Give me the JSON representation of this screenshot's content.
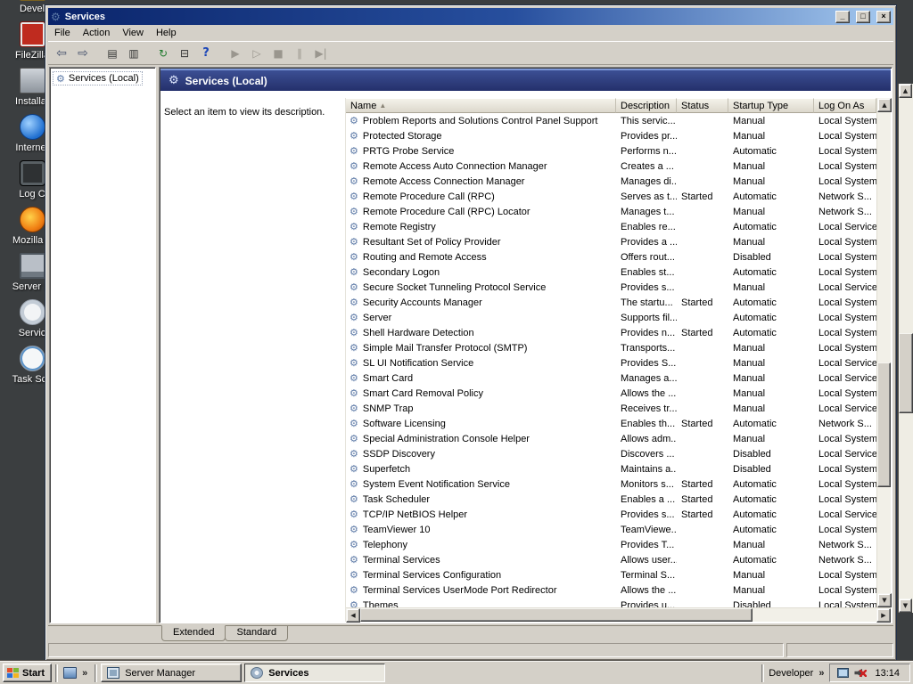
{
  "colors": {
    "desktop_background": "#3b3e40",
    "window_chrome": "#d4d0c8",
    "titlebar_gradient_left": "#0a246a",
    "titlebar_gradient_right": "#a6caf0",
    "pane_header_blue": "#24306b",
    "taskbar": "#d4d0c8"
  },
  "icons": {
    "gear_glyph": "⚙",
    "scroll_up": "▲",
    "scroll_down": "▼",
    "scroll_left": "◀",
    "scroll_right": "▶"
  },
  "desktop": {
    "icons": [
      {
        "label": "Devel",
        "icon": "developer-item-icon"
      },
      {
        "label": "FileZilla",
        "icon": "filezilla-icon"
      },
      {
        "label": "Installat",
        "icon": "installer-icon"
      },
      {
        "label": "Internet",
        "icon": "internet-icon"
      },
      {
        "label": "Log C",
        "icon": "log-icon"
      },
      {
        "label": "Mozilla F",
        "icon": "firefox-icon"
      },
      {
        "label": "Server M",
        "icon": "server-icon"
      },
      {
        "label": "Servic",
        "icon": "services-icon"
      },
      {
        "label": "Task Sch",
        "icon": "task-scheduler-icon"
      }
    ]
  },
  "window": {
    "title": "Services",
    "title_icon_glyph": "⚙",
    "controls": {
      "minimize": "_",
      "maximize": "□",
      "close": "×"
    },
    "menu_items": [
      {
        "label": "File"
      },
      {
        "label": "Action"
      },
      {
        "label": "View"
      },
      {
        "label": "Help"
      }
    ],
    "toolbar": [
      {
        "name": "back-button",
        "glyph": "⇦"
      },
      {
        "name": "forward-button",
        "glyph": "⇨"
      },
      {
        "name": "show-console-tree-button",
        "glyph": "▤"
      },
      {
        "name": "export-list-button",
        "glyph": "▥"
      },
      {
        "name": "refresh-button",
        "glyph": "↻"
      },
      {
        "name": "export-button",
        "glyph": "⊟"
      },
      {
        "name": "help-button",
        "glyph": "?"
      },
      {
        "name": "start-service-button",
        "glyph": "▶"
      },
      {
        "name": "resume-service-button",
        "glyph": "▷"
      },
      {
        "name": "stop-service-button",
        "glyph": "■"
      },
      {
        "name": "pause-service-button",
        "glyph": "∥"
      },
      {
        "name": "restart-service-button",
        "glyph": "▶|"
      }
    ],
    "tree_root": "Services (Local)",
    "pane_header": "Services (Local)",
    "description_hint": "Select an item to view its description.",
    "tabs": [
      {
        "label": "Extended",
        "selected": true
      },
      {
        "label": "Standard",
        "selected": false
      }
    ],
    "table": {
      "columns": [
        {
          "label": "Name",
          "sort_glyph": "▲"
        },
        {
          "label": "Description"
        },
        {
          "label": "Status"
        },
        {
          "label": "Startup Type"
        },
        {
          "label": "Log On As"
        }
      ],
      "rows": [
        {
          "name": "Problem Reports and Solutions Control Panel Support",
          "description": "This servic...",
          "status": "",
          "startup": "Manual",
          "logon": "Local System"
        },
        {
          "name": "Protected Storage",
          "description": "Provides pr...",
          "status": "",
          "startup": "Manual",
          "logon": "Local System"
        },
        {
          "name": "PRTG Probe Service",
          "description": "Performs n...",
          "status": "",
          "startup": "Automatic",
          "logon": "Local System"
        },
        {
          "name": "Remote Access Auto Connection Manager",
          "description": "Creates a ...",
          "status": "",
          "startup": "Manual",
          "logon": "Local System"
        },
        {
          "name": "Remote Access Connection Manager",
          "description": "Manages di...",
          "status": "",
          "startup": "Manual",
          "logon": "Local System"
        },
        {
          "name": "Remote Procedure Call (RPC)",
          "description": "Serves as t...",
          "status": "Started",
          "startup": "Automatic",
          "logon": "Network S..."
        },
        {
          "name": "Remote Procedure Call (RPC) Locator",
          "description": "Manages t...",
          "status": "",
          "startup": "Manual",
          "logon": "Network S..."
        },
        {
          "name": "Remote Registry",
          "description": "Enables re...",
          "status": "",
          "startup": "Automatic",
          "logon": "Local Service"
        },
        {
          "name": "Resultant Set of Policy Provider",
          "description": "Provides a ...",
          "status": "",
          "startup": "Manual",
          "logon": "Local System"
        },
        {
          "name": "Routing and Remote Access",
          "description": "Offers rout...",
          "status": "",
          "startup": "Disabled",
          "logon": "Local System"
        },
        {
          "name": "Secondary Logon",
          "description": "Enables st...",
          "status": "",
          "startup": "Automatic",
          "logon": "Local System"
        },
        {
          "name": "Secure Socket Tunneling Protocol Service",
          "description": "Provides s...",
          "status": "",
          "startup": "Manual",
          "logon": "Local Service"
        },
        {
          "name": "Security Accounts Manager",
          "description": "The startu...",
          "status": "Started",
          "startup": "Automatic",
          "logon": "Local System"
        },
        {
          "name": "Server",
          "description": "Supports fil...",
          "status": "",
          "startup": "Automatic",
          "logon": "Local System"
        },
        {
          "name": "Shell Hardware Detection",
          "description": "Provides n...",
          "status": "Started",
          "startup": "Automatic",
          "logon": "Local System"
        },
        {
          "name": "Simple Mail Transfer Protocol (SMTP)",
          "description": "Transports...",
          "status": "",
          "startup": "Manual",
          "logon": "Local System"
        },
        {
          "name": "SL UI Notification Service",
          "description": "Provides S...",
          "status": "",
          "startup": "Manual",
          "logon": "Local Service"
        },
        {
          "name": "Smart Card",
          "description": "Manages a...",
          "status": "",
          "startup": "Manual",
          "logon": "Local Service"
        },
        {
          "name": "Smart Card Removal Policy",
          "description": "Allows the ...",
          "status": "",
          "startup": "Manual",
          "logon": "Local System"
        },
        {
          "name": "SNMP Trap",
          "description": "Receives tr...",
          "status": "",
          "startup": "Manual",
          "logon": "Local Service"
        },
        {
          "name": "Software Licensing",
          "description": "Enables th...",
          "status": "Started",
          "startup": "Automatic",
          "logon": "Network S..."
        },
        {
          "name": "Special Administration Console Helper",
          "description": "Allows adm...",
          "status": "",
          "startup": "Manual",
          "logon": "Local System"
        },
        {
          "name": "SSDP Discovery",
          "description": "Discovers ...",
          "status": "",
          "startup": "Disabled",
          "logon": "Local Service"
        },
        {
          "name": "Superfetch",
          "description": "Maintains a...",
          "status": "",
          "startup": "Disabled",
          "logon": "Local System"
        },
        {
          "name": "System Event Notification Service",
          "description": "Monitors s...",
          "status": "Started",
          "startup": "Automatic",
          "logon": "Local System"
        },
        {
          "name": "Task Scheduler",
          "description": "Enables a ...",
          "status": "Started",
          "startup": "Automatic",
          "logon": "Local System"
        },
        {
          "name": "TCP/IP NetBIOS Helper",
          "description": "Provides s...",
          "status": "Started",
          "startup": "Automatic",
          "logon": "Local Service"
        },
        {
          "name": "TeamViewer 10",
          "description": "TeamViewe...",
          "status": "",
          "startup": "Automatic",
          "logon": "Local System"
        },
        {
          "name": "Telephony",
          "description": "Provides T...",
          "status": "",
          "startup": "Manual",
          "logon": "Network S..."
        },
        {
          "name": "Terminal Services",
          "description": "Allows user...",
          "status": "",
          "startup": "Automatic",
          "logon": "Network S..."
        },
        {
          "name": "Terminal Services Configuration",
          "description": "Terminal S...",
          "status": "",
          "startup": "Manual",
          "logon": "Local System"
        },
        {
          "name": "Terminal Services UserMode Port Redirector",
          "description": "Allows the ...",
          "status": "",
          "startup": "Manual",
          "logon": "Local System"
        },
        {
          "name": "Themes",
          "description": "Provides u...",
          "status": "",
          "startup": "Disabled",
          "logon": "Local System"
        }
      ]
    }
  },
  "taskbar": {
    "start": {
      "label": "Start"
    },
    "quick_launch": {
      "overflow_glyph": "»"
    },
    "task_buttons": [
      {
        "label": "Server Manager",
        "icon": "server-manager-icon",
        "active": false
      },
      {
        "label": "Services",
        "icon": "services-taskbtn-icon",
        "active": true
      }
    ],
    "tray": {
      "toolbar_label": "Developer",
      "toolbar_overflow_glyph": "»",
      "clock": "13:14"
    }
  }
}
